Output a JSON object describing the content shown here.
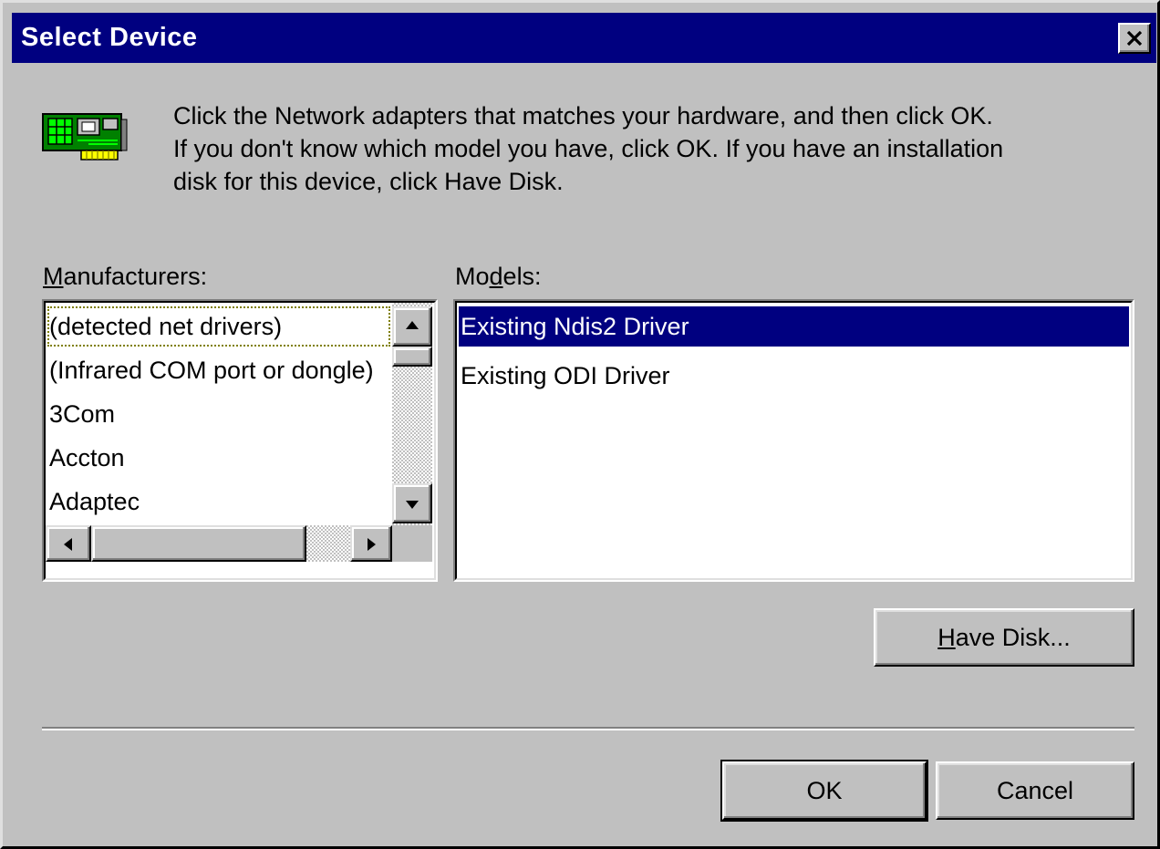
{
  "window": {
    "title": "Select Device",
    "close_symbol": "X"
  },
  "icon": "network-adapter-icon",
  "instructions": [
    "Click the Network adapters that matches your hardware, and then click OK.",
    "If you don't know which model you have, click OK. If you have an installation",
    "disk for this device, click Have Disk."
  ],
  "manufacturers": {
    "label_prefix": "",
    "label_accel": "M",
    "label_suffix": "anufacturers:",
    "items": [
      "(detected net drivers)",
      "(Infrared COM port or dongle)",
      "3Com",
      "Accton",
      "Adaptec"
    ],
    "focused_index": 0
  },
  "models": {
    "label_prefix": "Mo",
    "label_accel": "d",
    "label_suffix": "els:",
    "items": [
      "Existing Ndis2 Driver",
      "Existing ODI Driver"
    ],
    "selected_index": 0
  },
  "buttons": {
    "have_disk_prefix": "",
    "have_disk_accel": "H",
    "have_disk_suffix": "ave Disk...",
    "ok": "OK",
    "cancel": "Cancel"
  },
  "colors": {
    "title_bar": "#000080",
    "face": "#c0c0c0",
    "selection": "#000080"
  }
}
